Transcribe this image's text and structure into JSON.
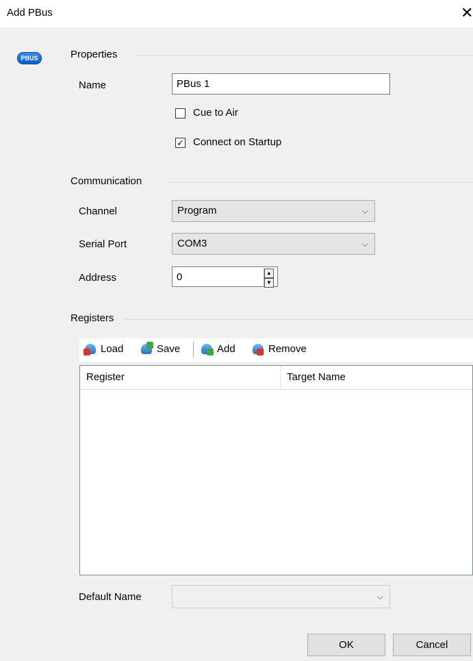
{
  "window": {
    "title": "Add PBus",
    "close_glyph": "✕"
  },
  "logo": {
    "text": "PBUS",
    "icon": "pbus-icon"
  },
  "properties": {
    "heading": "Properties",
    "name_label": "Name",
    "name_value": "PBus 1",
    "cue_to_air_label": "Cue to Air",
    "cue_to_air_checked": false,
    "connect_on_startup_label": "Connect on Startup",
    "connect_on_startup_checked": true,
    "check_glyph": "✓"
  },
  "communication": {
    "heading": "Communication",
    "channel_label": "Channel",
    "channel_value": "Program",
    "serial_port_label": "Serial Port",
    "serial_port_value": "COM3",
    "address_label": "Address",
    "address_value": "0",
    "dropdown_glyph": "⌵",
    "spin_up_glyph": "▲",
    "spin_down_glyph": "▼"
  },
  "registers": {
    "heading": "Registers",
    "toolbar": {
      "load_label": "Load",
      "save_label": "Save",
      "add_label": "Add",
      "remove_label": "Remove"
    },
    "columns": [
      "Register",
      "Target Name"
    ],
    "rows": []
  },
  "default_name": {
    "label": "Default Name",
    "value": ""
  },
  "buttons": {
    "ok": "OK",
    "cancel": "Cancel"
  },
  "colors": {
    "background": "#f0f0f0",
    "logo_blue": "#0b5cc6",
    "load_mark": "#d8352a",
    "save_mark": "#3aa846",
    "add_mark": "#3aa846",
    "remove_mark": "#d8352a"
  }
}
